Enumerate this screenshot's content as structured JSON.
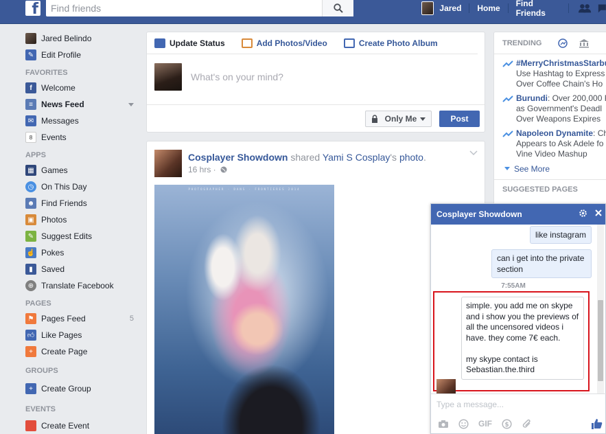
{
  "topbar": {
    "logo": "f",
    "search_placeholder": "Find friends",
    "user_name": "Jared",
    "home": "Home",
    "find_friends": "Find Friends"
  },
  "left": {
    "profile_name": "Jared Belindo",
    "edit_profile": "Edit Profile",
    "favorites_head": "FAVORITES",
    "favorites": [
      {
        "label": "Welcome",
        "icon": "facebook-icon",
        "color": "#3b5998"
      },
      {
        "label": "News Feed",
        "icon": "news-feed-icon",
        "color": "#5b7bb5"
      },
      {
        "label": "Messages",
        "icon": "messages-icon",
        "color": "#4267b2"
      },
      {
        "label": "Events",
        "icon": "calendar-icon",
        "color": "#e24d3c"
      }
    ],
    "apps_head": "APPS",
    "apps": [
      {
        "label": "Games",
        "icon": "games-icon",
        "color": "#2f477a"
      },
      {
        "label": "On This Day",
        "icon": "clock-icon",
        "color": "#4a90e2"
      },
      {
        "label": "Find Friends",
        "icon": "friends-icon",
        "color": "#5b7bb5"
      },
      {
        "label": "Photos",
        "icon": "photos-icon",
        "color": "#d88a3a"
      },
      {
        "label": "Suggest Edits",
        "icon": "pencil-icon",
        "color": "#7cb342"
      },
      {
        "label": "Pokes",
        "icon": "poke-icon",
        "color": "#4a7bc4"
      },
      {
        "label": "Saved",
        "icon": "bookmark-icon",
        "color": "#3b5998"
      },
      {
        "label": "Translate Facebook",
        "icon": "globe-icon",
        "color": "#7f7f7f"
      }
    ],
    "pages_head": "PAGES",
    "pages": [
      {
        "label": "Pages Feed",
        "icon": "flag-icon",
        "color": "#f0793c",
        "count": "5"
      },
      {
        "label": "Like Pages",
        "icon": "thumbs-up-icon",
        "color": "#4267b2",
        "count": ""
      },
      {
        "label": "Create Page",
        "icon": "plus-icon",
        "color": "#f0793c",
        "count": ""
      }
    ],
    "groups_head": "GROUPS",
    "create_group": "Create Group",
    "events_head": "EVENTS",
    "events_item": "Create Event"
  },
  "composer": {
    "tab_status": "Update Status",
    "tab_photos": "Add Photos/Video",
    "tab_album": "Create Photo Album",
    "placeholder": "What's on your mind?",
    "privacy": "Only Me",
    "post": "Post"
  },
  "post": {
    "author": "Cosplayer Showdown",
    "action": " shared ",
    "source": "Yami S Cosplay",
    "suffix": "'s ",
    "object": "photo",
    "end": ".",
    "time": "16 hrs ·",
    "photo_credit": "PHOTOGRAPHER · DANS · FRONTIERES 2014"
  },
  "trending": {
    "head": "TRENDING",
    "items": [
      {
        "title": "#MerryChristmasStarbucks",
        "line1": "Use Hashtag to Express",
        "line2": "Over Coffee Chain's Ho"
      },
      {
        "title": "Burundi",
        "title_rest": ": Over 200,000 F",
        "line1": "as Government's Deadl",
        "line2": "Over Weapons Expires"
      },
      {
        "title": "Napoleon Dynamite",
        "title_rest": ": Cha",
        "line1": "Appears to Ask Adele fo",
        "line2": "Vine Video Mashup"
      }
    ],
    "see_more": "See More",
    "suggested": "SUGGESTED PAGES"
  },
  "chat": {
    "title": "Cosplayer Showdown",
    "msg1": "like instagram",
    "msg2": "can i get into the private section",
    "timestamp": "7:55AM",
    "msg3": "simple. you add me on skype and i show you the previews of all the uncensored videos i have. they come 7€ each.\n\nmy skype contact is Sebastian.the.third",
    "input_placeholder": "Type a message...",
    "gif": "GIF"
  }
}
